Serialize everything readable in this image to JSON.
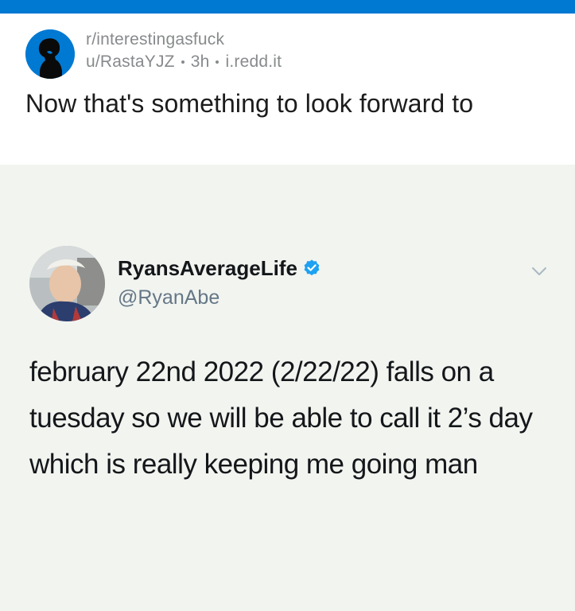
{
  "header": {
    "subreddit": "r/interestingasfuck",
    "user": "u/RastaYJZ",
    "time": "3h",
    "domain": "i.redd.it",
    "accent_color": "#0079d3"
  },
  "post": {
    "title": "Now that's something to look forward to"
  },
  "tweet": {
    "display_name": "RyansAverageLife",
    "handle": "@RyanAbe",
    "verified": true,
    "text": "february 22nd 2022 (2/22/22) falls on a tuesday so we will be able to call it 2’s day which is really keeping me going man",
    "icons": [
      "verified-badge-icon",
      "chevron-down-icon"
    ]
  }
}
